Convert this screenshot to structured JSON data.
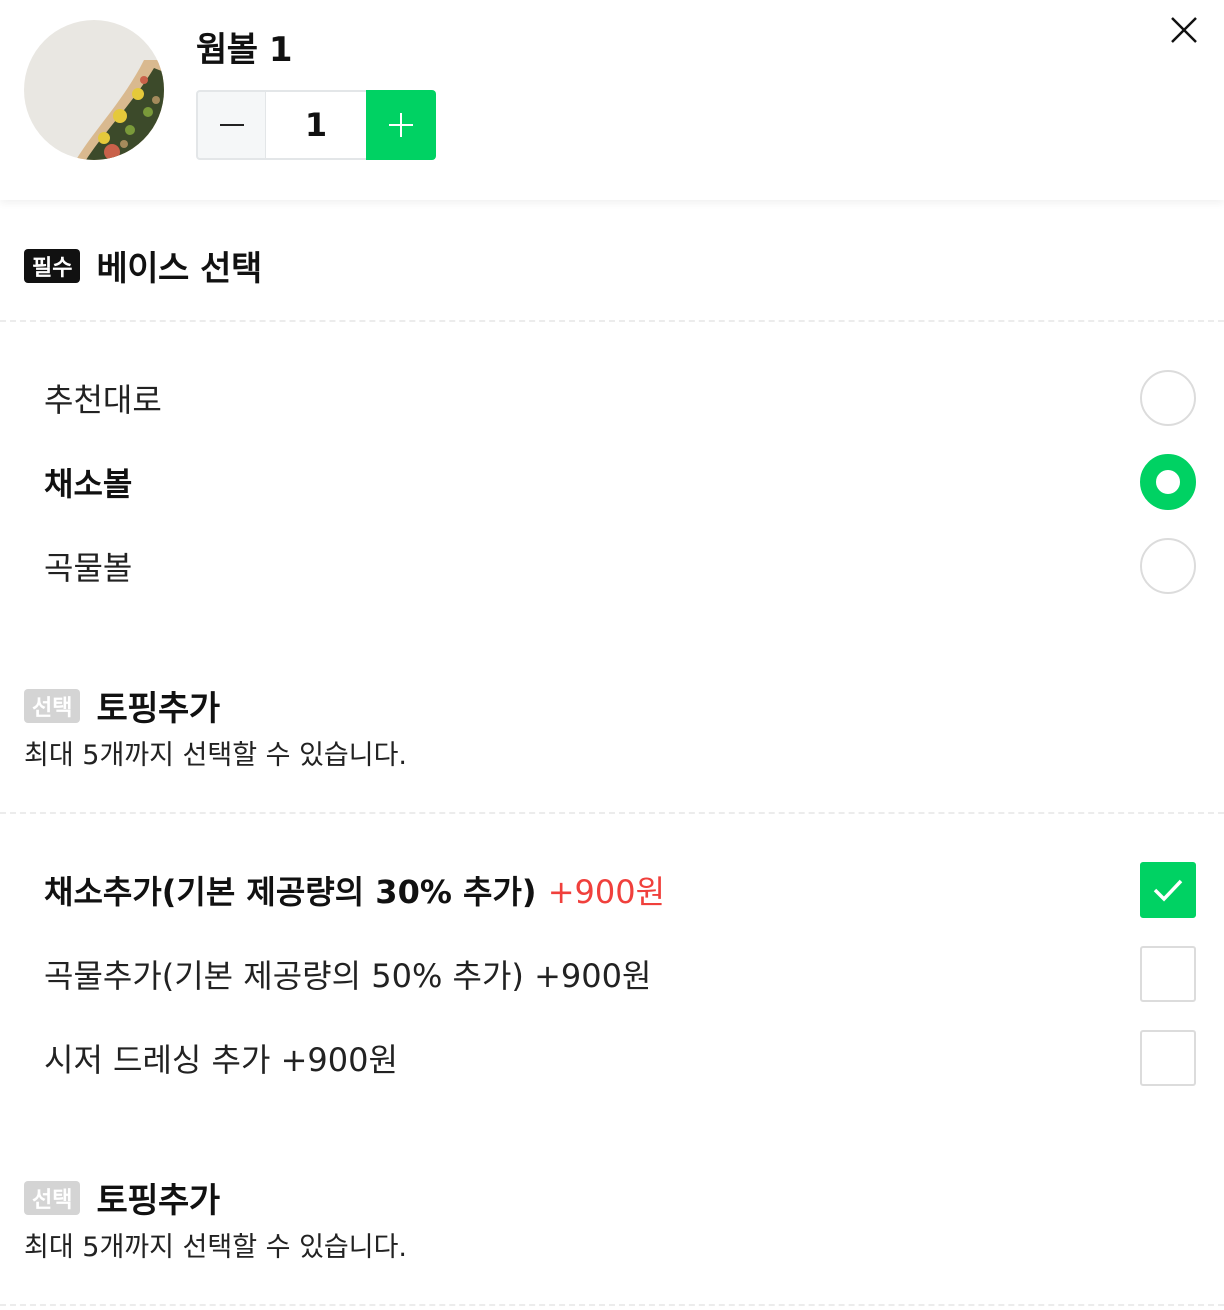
{
  "product": {
    "name": "웜볼 1",
    "quantity": "1"
  },
  "colors": {
    "accent": "#00d263",
    "price_highlight": "#f0403c"
  },
  "sections": [
    {
      "badge": "필수",
      "title": "베이스 선택",
      "options": [
        {
          "label": "추천대로",
          "selected": false
        },
        {
          "label": "채소볼",
          "selected": true
        },
        {
          "label": "곡물볼",
          "selected": false
        }
      ]
    },
    {
      "badge": "선택",
      "title": "토핑추가",
      "description": "최대 5개까지 선택할 수 있습니다.",
      "options": [
        {
          "label": "채소추가(기본 제공량의 30% 추가)",
          "price": "+900원",
          "selected": true
        },
        {
          "label": "곡물추가(기본 제공량의 50% 추가)",
          "price": "+900원",
          "selected": false
        },
        {
          "label": "시저 드레싱 추가",
          "price": "+900원",
          "selected": false
        }
      ]
    },
    {
      "badge": "선택",
      "title": "토핑추가",
      "description": "최대 5개까지 선택할 수 있습니다."
    }
  ],
  "icons": {
    "close": "close-icon",
    "minus": "minus-icon",
    "plus": "plus-icon",
    "check": "check-icon"
  }
}
